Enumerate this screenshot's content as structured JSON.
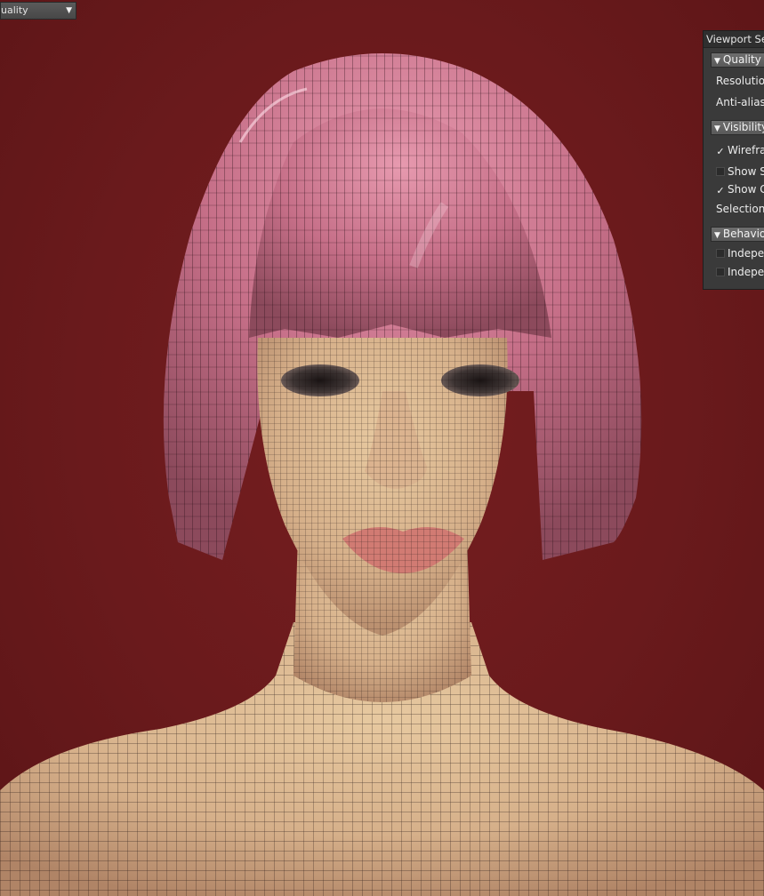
{
  "viewport": {
    "background_color": "#6a1a1c",
    "quality_dropdown": {
      "value": "uality",
      "caret_icon": "chevron-down-icon"
    }
  },
  "panel": {
    "title": "Viewport Set",
    "sections": [
      {
        "label": "Quality",
        "rows": [
          {
            "label": "Resolution",
            "kind": "text"
          },
          {
            "label": "Anti-aliasi",
            "kind": "text"
          }
        ]
      },
      {
        "label": "Visibility",
        "rows": [
          {
            "label": "Wirefran",
            "kind": "check",
            "checked": true
          },
          {
            "label": "Show Se",
            "kind": "check",
            "checked": false
          },
          {
            "label": "Show G",
            "kind": "check",
            "checked": true
          },
          {
            "label": "Selection I",
            "kind": "text"
          }
        ]
      },
      {
        "label": "Behavior",
        "rows": [
          {
            "label": "Indepen",
            "kind": "check",
            "checked": false
          },
          {
            "label": "Indepen",
            "kind": "check",
            "checked": false
          }
        ]
      }
    ]
  },
  "colors": {
    "hair": "#c86f88",
    "skin": "#dcb98e",
    "wireframe": "#1a0d0d"
  }
}
